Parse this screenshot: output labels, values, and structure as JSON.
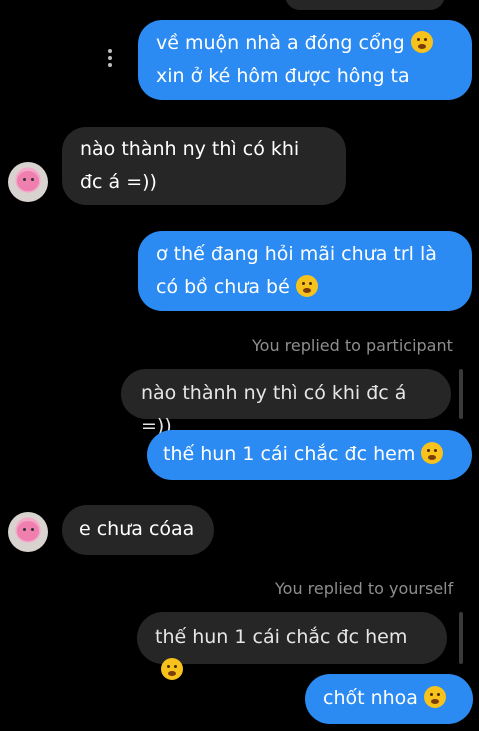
{
  "messages": [
    {
      "id": "m0",
      "side": "out",
      "lines": [
        "về muộn nhà a đóng cổng",
        "xin ở ké hôm được hông ta"
      ],
      "emoji": "smiling-face-emoji"
    },
    {
      "id": "m1",
      "side": "in",
      "lines": [
        "nào thành ny thì có khi",
        "đc á =))"
      ]
    },
    {
      "id": "m2",
      "side": "out",
      "lines": [
        "ơ thế đang hỏi mãi chưa trl là",
        "có bồ chưa bé"
      ],
      "emoji": "rolling-laughing-emoji"
    },
    {
      "id": "m3",
      "reply_label": "You replied to participant",
      "quoted": "nào thành ny thì có khi đc á =))"
    },
    {
      "id": "m4",
      "side": "out",
      "lines": [
        "thế hun 1 cái chắc đc hem"
      ],
      "emoji": "flushed-face-emoji"
    },
    {
      "id": "m5",
      "side": "in",
      "lines": [
        "e chưa cóaa"
      ]
    },
    {
      "id": "m6",
      "reply_label": "You replied to yourself",
      "quoted": "thế hun 1 cái chắc đc hem"
    },
    {
      "id": "m7",
      "side": "out",
      "lines": [
        "chốt nhoa"
      ],
      "emoji": "kissing-face-emoji"
    }
  ],
  "colors": {
    "outgoing": "#2b8bf2",
    "incoming": "#262626",
    "background": "#000000",
    "label": "#8e8e8e"
  }
}
